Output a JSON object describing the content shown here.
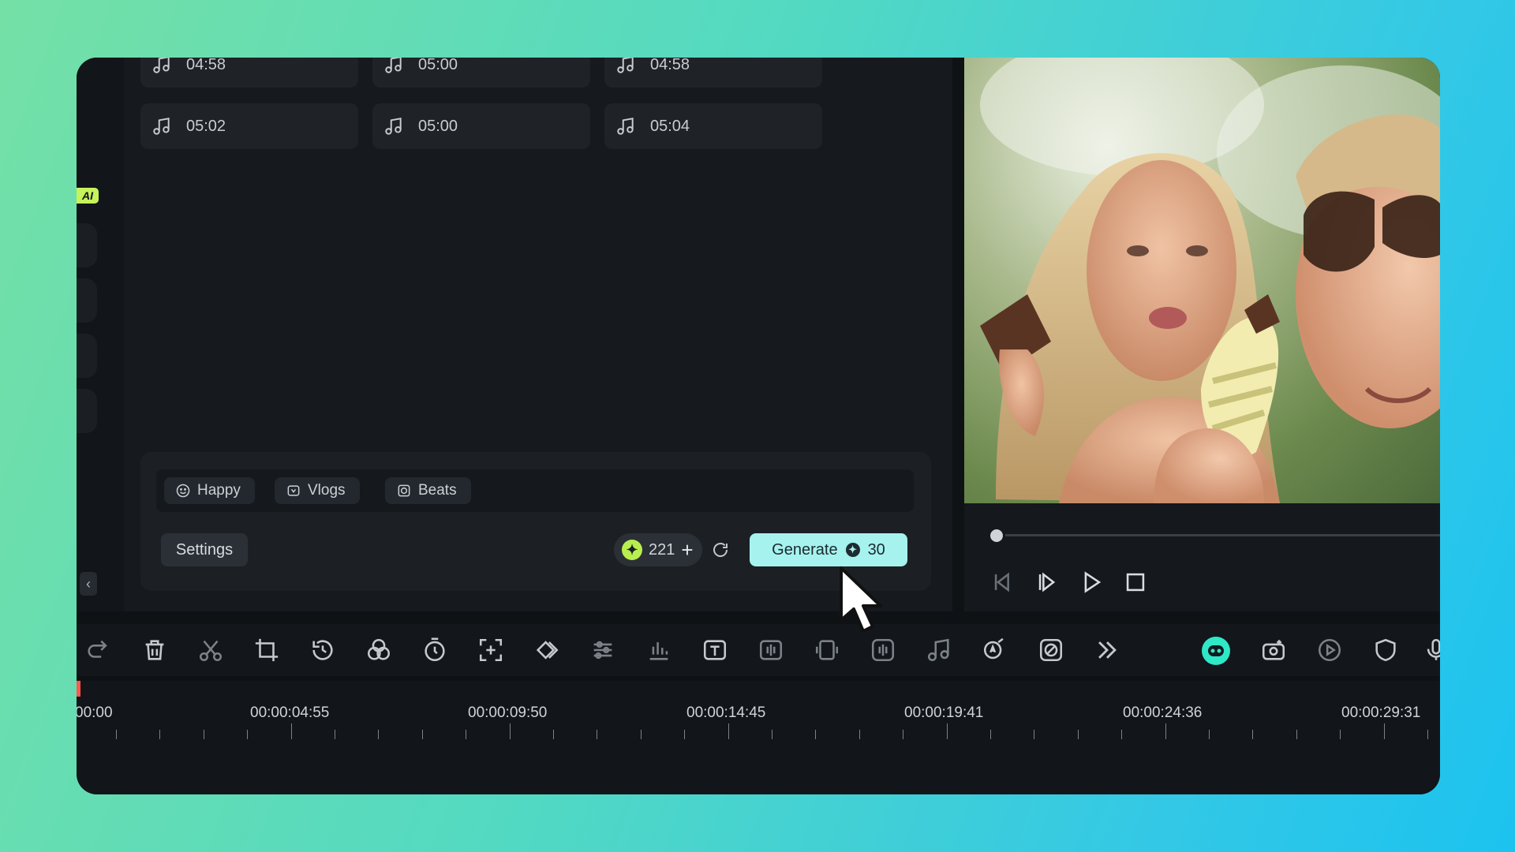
{
  "tracks": [
    {
      "duration": "04:58"
    },
    {
      "duration": "05:00"
    },
    {
      "duration": "04:58"
    },
    {
      "duration": "05:02"
    },
    {
      "duration": "05:00"
    },
    {
      "duration": "05:04"
    }
  ],
  "sidebar": {
    "ai_badge": "AI",
    "collapse_glyph": "‹"
  },
  "prompt": {
    "tags": [
      {
        "label": "Happy",
        "icon": "smile-icon"
      },
      {
        "label": "Vlogs",
        "icon": "vlog-icon"
      },
      {
        "label": "Beats",
        "icon": "beats-icon"
      }
    ],
    "settings_label": "Settings",
    "credits": "221",
    "credits_plus": "+",
    "generate_label": "Generate",
    "generate_cost": "30"
  },
  "timeline": {
    "labels": [
      "00:00",
      "00:00:04:55",
      "00:00:09:50",
      "00:00:14:45",
      "00:00:19:41",
      "00:00:24:36",
      "00:00:29:31"
    ]
  },
  "colors": {
    "accent_generate": "#a6f2ee",
    "credit_coin": "#b9ee4f",
    "playhead": "#ff5a4e",
    "ai_bot": "#2ee8c7"
  }
}
